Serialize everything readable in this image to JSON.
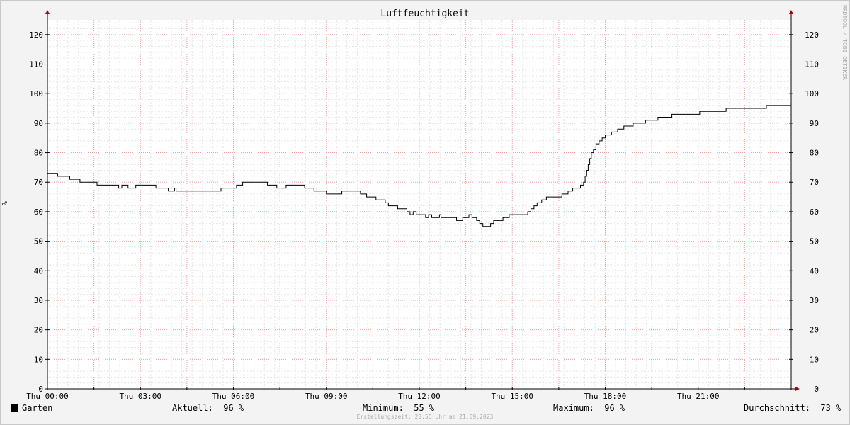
{
  "chart_data": {
    "type": "line",
    "title": "Luftfeuchtigkeit",
    "ylabel": "%",
    "ylim": [
      0,
      125
    ],
    "yticks": [
      0,
      10,
      20,
      30,
      40,
      50,
      60,
      70,
      80,
      90,
      100,
      110,
      120
    ],
    "xlim_hours": [
      0,
      24
    ],
    "xticks": [
      {
        "h": 0,
        "label": "Thu 00:00"
      },
      {
        "h": 3,
        "label": "Thu 03:00"
      },
      {
        "h": 6,
        "label": "Thu 06:00"
      },
      {
        "h": 9,
        "label": "Thu 09:00"
      },
      {
        "h": 12,
        "label": "Thu 12:00"
      },
      {
        "h": 15,
        "label": "Thu 15:00"
      },
      {
        "h": 18,
        "label": "Thu 18:00"
      },
      {
        "h": 21,
        "label": "Thu 21:00"
      }
    ],
    "grid": true,
    "side_text": "RRDTOOL / TOBI OETIKER",
    "series": [
      {
        "name": "Garten",
        "color": "#000000",
        "step": true,
        "points": [
          [
            0,
            73
          ],
          [
            0.33,
            72
          ],
          [
            0.72,
            71
          ],
          [
            1.05,
            70
          ],
          [
            1.6,
            69
          ],
          [
            2.3,
            68
          ],
          [
            2.4,
            69
          ],
          [
            2.6,
            68
          ],
          [
            2.85,
            69
          ],
          [
            3.5,
            68
          ],
          [
            3.9,
            67
          ],
          [
            4.1,
            68
          ],
          [
            4.15,
            67
          ],
          [
            5.0,
            67
          ],
          [
            5.6,
            68
          ],
          [
            6.1,
            69
          ],
          [
            6.3,
            70
          ],
          [
            7.1,
            69
          ],
          [
            7.4,
            68
          ],
          [
            7.7,
            69
          ],
          [
            8.3,
            68
          ],
          [
            8.6,
            67
          ],
          [
            9.0,
            66
          ],
          [
            9.3,
            66
          ],
          [
            9.5,
            67
          ],
          [
            10.0,
            67
          ],
          [
            10.1,
            66
          ],
          [
            10.3,
            65
          ],
          [
            10.6,
            64
          ],
          [
            10.9,
            63
          ],
          [
            11.0,
            62
          ],
          [
            11.3,
            61
          ],
          [
            11.6,
            60
          ],
          [
            11.7,
            59
          ],
          [
            11.8,
            60
          ],
          [
            11.9,
            59
          ],
          [
            12.1,
            59
          ],
          [
            12.2,
            58
          ],
          [
            12.3,
            59
          ],
          [
            12.4,
            58
          ],
          [
            12.6,
            58
          ],
          [
            12.65,
            59
          ],
          [
            12.7,
            58
          ],
          [
            13.2,
            57
          ],
          [
            13.4,
            58
          ],
          [
            13.6,
            59
          ],
          [
            13.7,
            58
          ],
          [
            13.85,
            57
          ],
          [
            13.95,
            56
          ],
          [
            14.05,
            55
          ],
          [
            14.3,
            56
          ],
          [
            14.4,
            57
          ],
          [
            14.7,
            58
          ],
          [
            14.9,
            59
          ],
          [
            15.1,
            59
          ],
          [
            15.5,
            60
          ],
          [
            15.6,
            61
          ],
          [
            15.7,
            62
          ],
          [
            15.8,
            63
          ],
          [
            15.95,
            64
          ],
          [
            16.1,
            65
          ],
          [
            16.6,
            66
          ],
          [
            16.8,
            67
          ],
          [
            16.95,
            68
          ],
          [
            17.2,
            69
          ],
          [
            17.3,
            70
          ],
          [
            17.35,
            72
          ],
          [
            17.4,
            74
          ],
          [
            17.45,
            76
          ],
          [
            17.5,
            78
          ],
          [
            17.55,
            80
          ],
          [
            17.62,
            81
          ],
          [
            17.7,
            83
          ],
          [
            17.8,
            84
          ],
          [
            17.9,
            85
          ],
          [
            18.0,
            86
          ],
          [
            18.2,
            87
          ],
          [
            18.4,
            88
          ],
          [
            18.6,
            89
          ],
          [
            18.9,
            90
          ],
          [
            19.3,
            91
          ],
          [
            19.7,
            92
          ],
          [
            20.15,
            93
          ],
          [
            21.05,
            94
          ],
          [
            21.9,
            95
          ],
          [
            23.2,
            96
          ],
          [
            24,
            96
          ]
        ]
      }
    ]
  },
  "legend": {
    "series_name": "Garten",
    "current": "Aktuell:  96 %",
    "minimum": "Minimum:  55 %",
    "maximum": "Maximum:  96 %",
    "average": "Durchschnitt:  73 %"
  },
  "footer": "Erstellungszeit: 23:55 Uhr am 21.09.2023"
}
